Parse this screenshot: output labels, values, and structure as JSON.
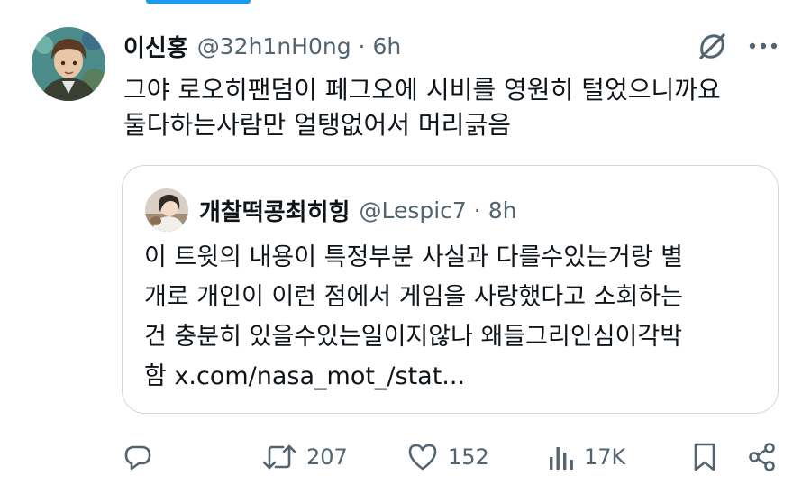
{
  "tweet": {
    "display_name": "이신홍",
    "handle": "@32h1nH0ng",
    "separator": "·",
    "time": "6h",
    "text_line1": "그야 로오히팬덤이 페그오에 시비를 영원히 털었으니까요",
    "text_line2": "둘다하는사람만 얼탱없어서 머리긁음"
  },
  "quote": {
    "display_name": "개찰떡콩최히힝",
    "handle": "@Lespic7",
    "separator": "·",
    "time": "8h",
    "text_line1": "이 트윗의 내용이 특정부분 사실과 다를수있는거랑 별",
    "text_line2": "개로 개인이 이런 점에서 게임을 사랑했다고 소회하는",
    "text_line3": "건 충분히 있을수있는일이지않나 왜들그리인심이각박",
    "text_line4": "함 x.com/nasa_mot_/stat..."
  },
  "actions": {
    "reply_count": "",
    "retweet_count": "207",
    "like_count": "152",
    "view_count": "17K"
  },
  "icons": {
    "grok": "grok-icon",
    "more": "more-dots-icon",
    "reply": "reply-bubble-icon",
    "retweet": "retweet-arrows-icon",
    "like": "heart-icon",
    "views": "bar-chart-icon",
    "bookmark": "bookmark-icon",
    "share": "share-icon"
  },
  "colors": {
    "text": "#0f1419",
    "secondary": "#536471",
    "border": "#cfd9de",
    "accent": "#1d9bf0"
  }
}
